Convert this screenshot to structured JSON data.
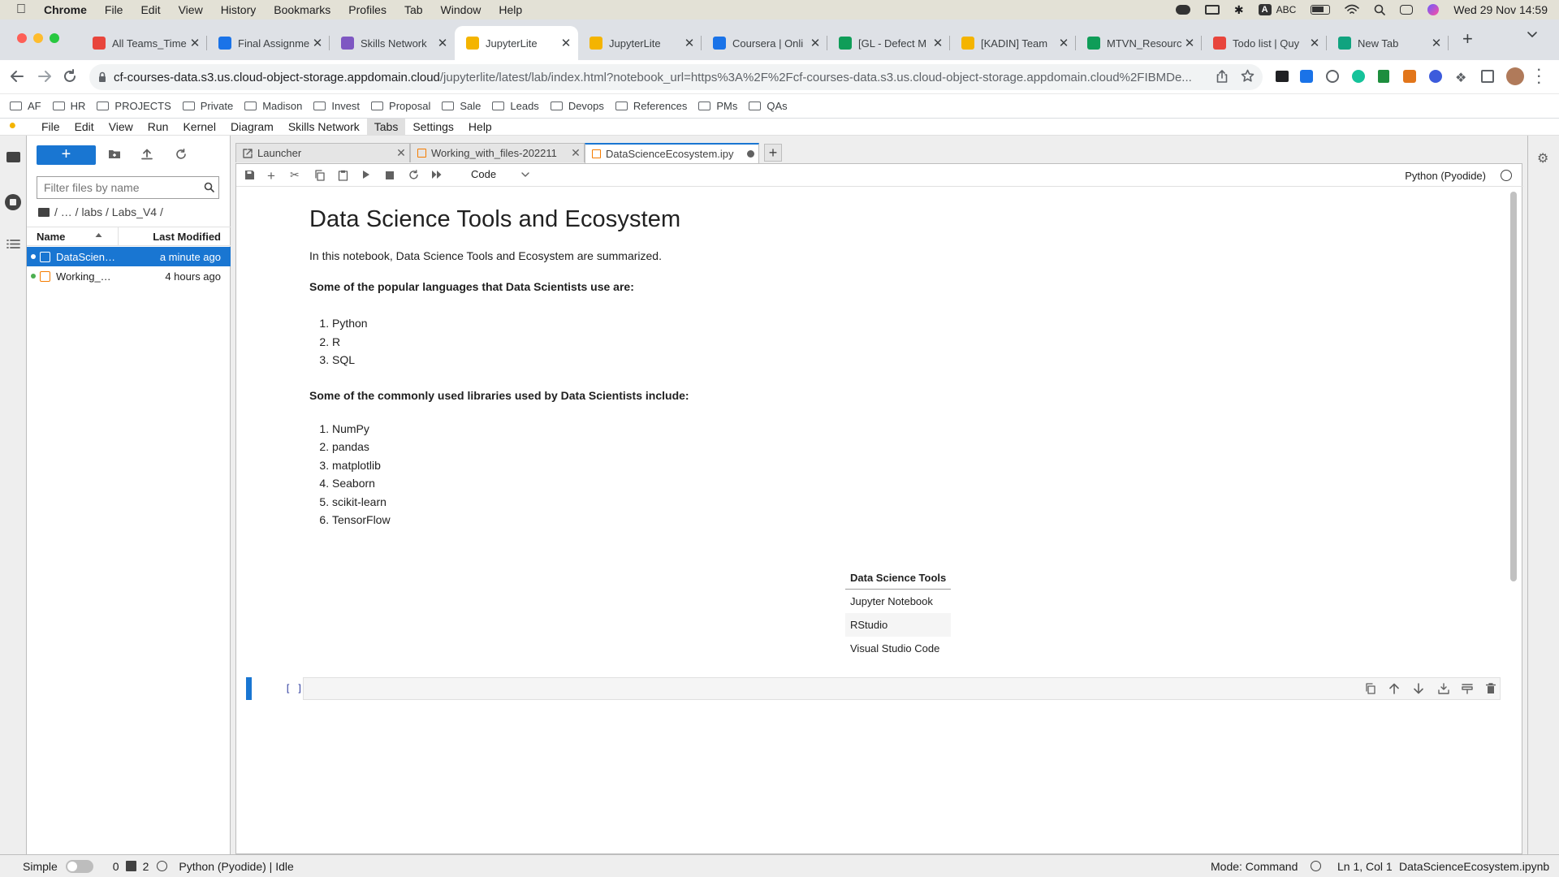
{
  "mac": {
    "app": "Chrome",
    "menu": [
      "File",
      "Edit",
      "View",
      "History",
      "Bookmarks",
      "Profiles",
      "Tab",
      "Window",
      "Help"
    ],
    "input_source": "ABC",
    "clock": "Wed 29 Nov  14:59"
  },
  "chrome": {
    "tabs": [
      {
        "title": "All Teams_Time",
        "favicon_color": "#e8453c",
        "icon": "app-icon"
      },
      {
        "title": "Final Assignme",
        "favicon_color": "#1a73e8",
        "icon": "coursera-icon"
      },
      {
        "title": "Skills Network",
        "favicon_color": "#7e57c2",
        "icon": "skills-network-icon"
      },
      {
        "title": "JupyterLite",
        "favicon_color": "#f4b400",
        "icon": "jupyterlite-icon",
        "active": true
      },
      {
        "title": "JupyterLite",
        "favicon_color": "#f4b400",
        "icon": "jupyterlite-icon"
      },
      {
        "title": "Coursera | Onli",
        "favicon_color": "#1a73e8",
        "icon": "coursera-icon"
      },
      {
        "title": "[GL - Defect M",
        "favicon_color": "#0f9d58",
        "icon": "sheets-icon"
      },
      {
        "title": "[KADIN] Team",
        "favicon_color": "#f4b400",
        "icon": "slides-icon"
      },
      {
        "title": "MTVN_Resourc",
        "favicon_color": "#0f9d58",
        "icon": "sheets-icon"
      },
      {
        "title": "Todo list | Quy",
        "favicon_color": "#e8453c",
        "icon": "clickup-icon"
      },
      {
        "title": "New Tab",
        "favicon_color": "#10a37f",
        "icon": "chatgpt-icon"
      }
    ],
    "url_host": "cf-courses-data.s3.us.cloud-object-storage.appdomain.cloud",
    "url_path": "/jupyterlite/latest/lab/index.html?notebook_url=https%3A%2F%2Fcf-courses-data.s3.us.cloud-object-storage.appdomain.cloud%2FIBMDe...",
    "bookmarks": [
      "AF",
      "HR",
      "PROJECTS",
      "Private",
      "Madison",
      "Invest",
      "Proposal",
      "Sale",
      "Leads",
      "Devops",
      "References",
      "PMs",
      "QAs"
    ]
  },
  "jupyter": {
    "menu": [
      "File",
      "Edit",
      "View",
      "Run",
      "Kernel",
      "Diagram",
      "Skills Network",
      "Tabs",
      "Settings",
      "Help"
    ],
    "filebrowser": {
      "new_label": "+",
      "filter_placeholder": "Filter files by name",
      "path": "/ … / labs / Labs_V4 /",
      "col_name": "Name",
      "col_modified": "Last Modified",
      "files": [
        {
          "name": "DataScien…",
          "modified": "a minute ago",
          "selected": true
        },
        {
          "name": "Working_…",
          "modified": "4 hours ago",
          "selected": false
        }
      ]
    },
    "doc_tabs": [
      {
        "title": "Launcher"
      },
      {
        "title": "Working_with_files-202211"
      },
      {
        "title": "DataScienceEcosystem.ipy"
      }
    ],
    "toolbar": {
      "cell_type": "Code",
      "kernel": "Python (Pyodide)"
    },
    "notebook": {
      "title": "Data Science Tools and Ecosystem",
      "intro": "In this notebook, Data Science Tools and Ecosystem are summarized.",
      "languages_heading": "Some of the popular languages that Data Scientists use are:",
      "languages": [
        "Python",
        "R",
        "SQL"
      ],
      "libraries_heading": "Some of the commonly used libraries used by Data Scientists include:",
      "libraries": [
        "NumPy",
        "pandas",
        "matplotlib",
        "Seaborn",
        "scikit-learn",
        "TensorFlow"
      ],
      "table_header": "Data Science Tools",
      "table_rows": [
        "Jupyter Notebook",
        "RStudio",
        "Visual Studio Code"
      ],
      "prompt": "[ ]:"
    },
    "status": {
      "mode_label": "Simple",
      "terminals": "0",
      "kernels": "2",
      "kernel_status": "Python (Pyodide) | Idle",
      "mode": "Mode: Command",
      "position": "Ln 1, Col 1",
      "filename": "DataScienceEcosystem.ipynb"
    }
  }
}
